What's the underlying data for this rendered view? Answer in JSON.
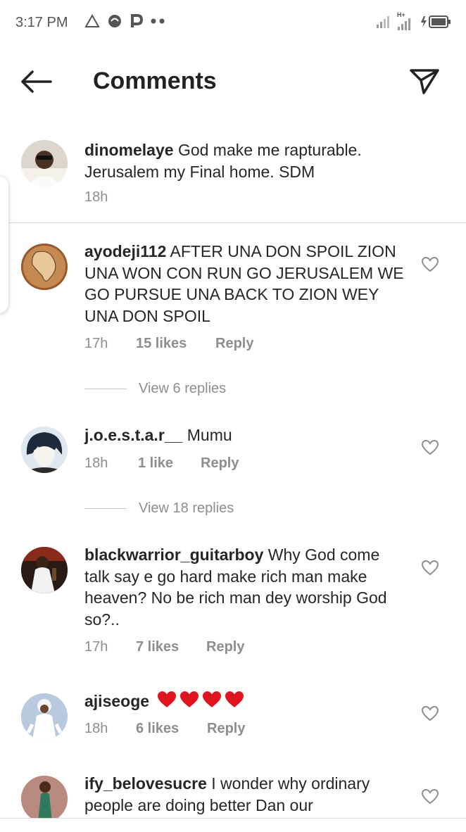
{
  "status_bar": {
    "time": "3:17 PM",
    "network": "H+"
  },
  "header": {
    "title": "Comments"
  },
  "caption": {
    "username": "dinomelaye",
    "text": "God make me rapturable. Jerusalem my Final home. SDM",
    "time": "18h"
  },
  "comments": [
    {
      "username": "ayodeji112",
      "text": "AFTER UNA DON SPOIL ZION UNA WON CON RUN GO JERUSALEM WE GO PURSUE UNA BACK TO ZION WEY UNA DON SPOIL",
      "time": "17h",
      "likes": "15 likes",
      "reply": "Reply",
      "view_replies": "View 6 replies"
    },
    {
      "username": "j.o.e.s.t.a.r__",
      "text": "Mumu",
      "time": "18h",
      "likes": "1 like",
      "reply": "Reply",
      "view_replies": "View 18 replies"
    },
    {
      "username": "blackwarrior_guitarboy",
      "text": "Why God come talk say e go hard make rich man make heaven? No be rich man dey worship God so?..",
      "time": "17h",
      "likes": "7 likes",
      "reply": "Reply"
    },
    {
      "username": "ajiseoge",
      "text": "",
      "hearts": [
        "heart-emoji",
        "heart-emoji",
        "heart-emoji",
        "heart-emoji"
      ],
      "time": "18h",
      "likes": "6 likes",
      "reply": "Reply"
    },
    {
      "username": "ify_belovesucre",
      "text": "I wonder why ordinary people are doing better Dan our"
    }
  ],
  "colors": {
    "text": "#262626",
    "secondary": "#8e8e8e",
    "heart_red": "#e0141e"
  }
}
